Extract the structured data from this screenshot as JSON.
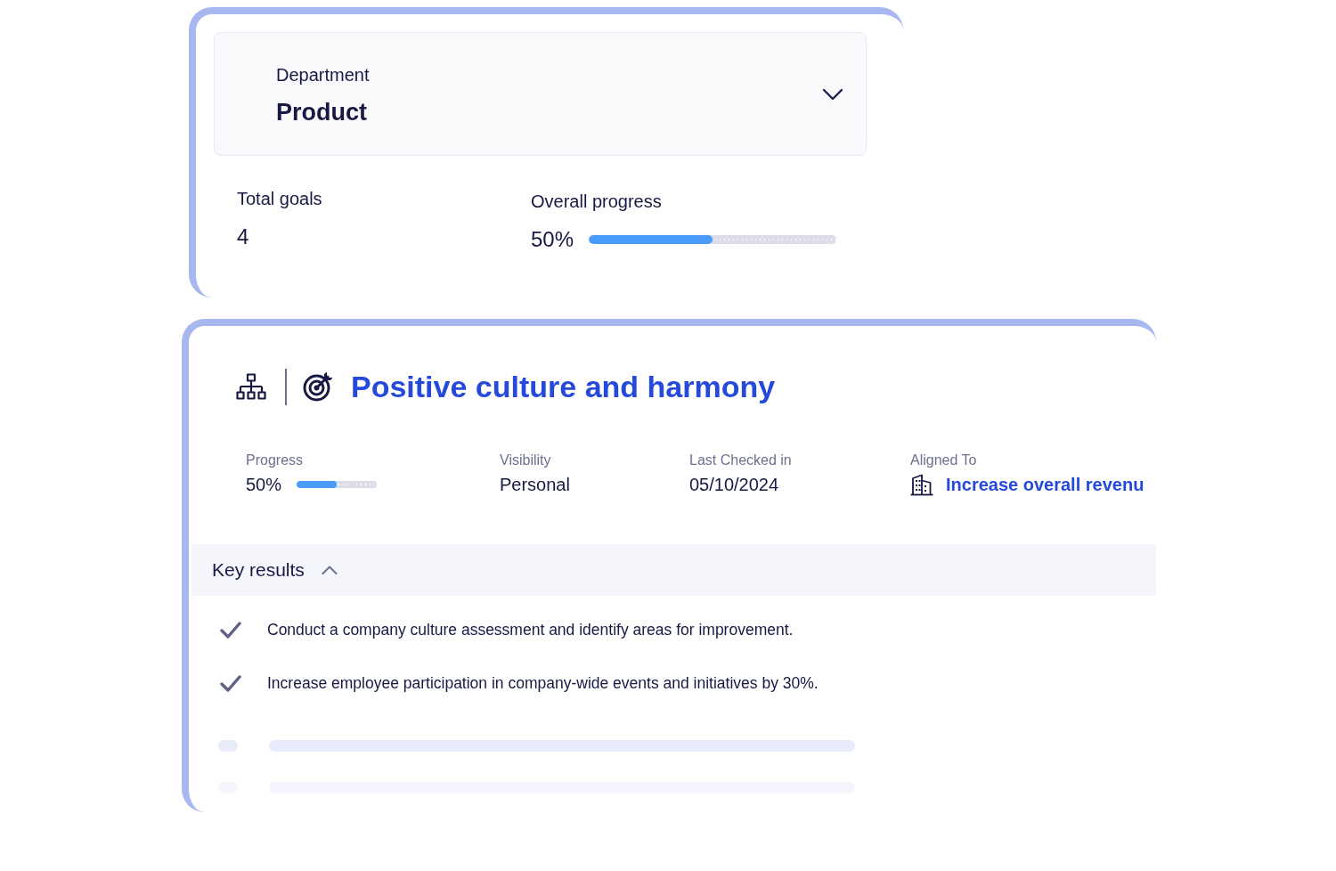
{
  "summary_card": {
    "department_select": {
      "label": "Department",
      "value": "Product"
    },
    "stats": [
      {
        "kind": "number",
        "label": "Total goals",
        "value": "4"
      },
      {
        "kind": "progress",
        "label": "Overall progress",
        "value": "50%",
        "level": 0.5
      }
    ]
  },
  "goal_card": {
    "title": "Positive culture and harmony",
    "meta": [
      {
        "kind": "progress",
        "label": "Progress",
        "value": "50%",
        "level": 0.5
      },
      {
        "kind": "text",
        "label": "Visibility",
        "value": "Personal"
      },
      {
        "kind": "text",
        "label": "Last Checked in",
        "value": "05/10/2024"
      },
      {
        "kind": "link",
        "label": "Aligned To",
        "value": "Increase overall revenu"
      }
    ],
    "key_results": {
      "title": "Key results",
      "expanded": true,
      "items": [
        {
          "kind": "result",
          "text": "Conduct a company culture assessment and identify areas for improvement.",
          "done": true
        },
        {
          "kind": "result",
          "text": "Increase employee participation in company-wide events and initiatives by 30%.",
          "done": true
        },
        {
          "kind": "skeleton"
        },
        {
          "kind": "skeleton"
        }
      ]
    }
  }
}
